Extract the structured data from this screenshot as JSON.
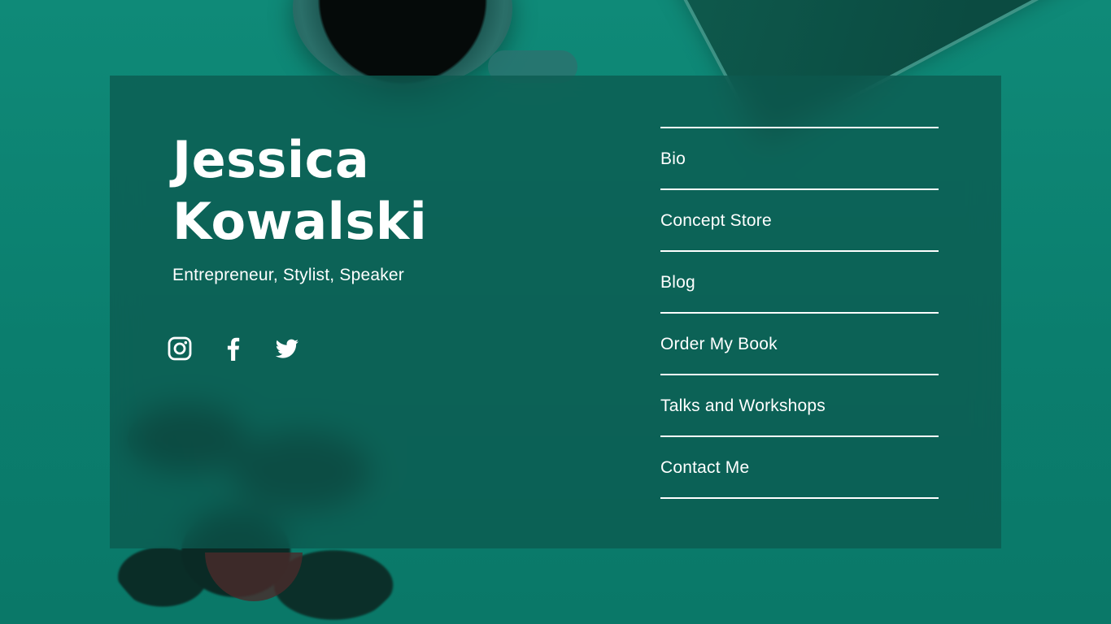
{
  "profile": {
    "first_name": "Jessica",
    "last_name": "Kowalski",
    "tagline": "Entrepreneur, Stylist, Speaker"
  },
  "social": {
    "icons": [
      "instagram-icon",
      "facebook-icon",
      "twitter-icon"
    ]
  },
  "nav": {
    "items": [
      {
        "label": "Bio"
      },
      {
        "label": "Concept Store"
      },
      {
        "label": "Blog"
      },
      {
        "label": "Order My Book"
      },
      {
        "label": "Talks and Workshops"
      },
      {
        "label": "Contact Me"
      }
    ]
  },
  "colors": {
    "background": "#0d8574",
    "panel": "#0c584e",
    "text": "#ffffff"
  }
}
